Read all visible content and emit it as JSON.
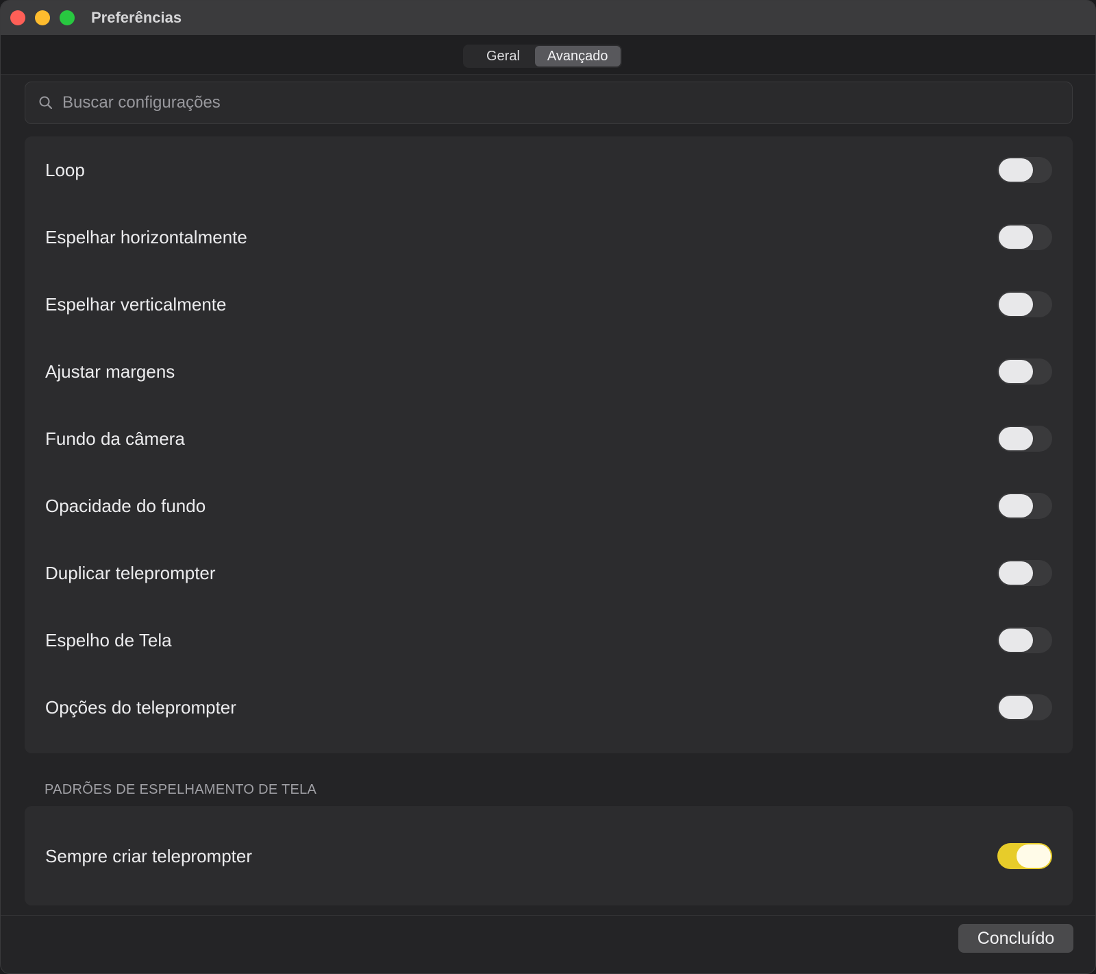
{
  "window": {
    "title": "Preferências"
  },
  "tabs": [
    {
      "label": "Geral",
      "active": false
    },
    {
      "label": "Avançado",
      "active": true
    }
  ],
  "search": {
    "placeholder": "Buscar configurações",
    "value": "",
    "icon": "search-icon"
  },
  "settings": [
    {
      "label": "Loop",
      "on": false
    },
    {
      "label": "Espelhar horizontalmente",
      "on": false
    },
    {
      "label": "Espelhar verticalmente",
      "on": false
    },
    {
      "label": "Ajustar margens",
      "on": false
    },
    {
      "label": "Fundo da câmera",
      "on": false
    },
    {
      "label": "Opacidade do fundo",
      "on": false
    },
    {
      "label": "Duplicar teleprompter",
      "on": false
    },
    {
      "label": "Espelho de Tela",
      "on": false
    },
    {
      "label": "Opções do teleprompter",
      "on": false
    }
  ],
  "mirror_section": {
    "heading": "PADRÕES DE ESPELHAMENTO DE TELA",
    "settings": [
      {
        "label": "Sempre criar teleprompter",
        "on": true
      }
    ]
  },
  "footer": {
    "done_label": "Concluído"
  },
  "colors": {
    "accent_on": "#e7cc2a",
    "close": "#ff5f57",
    "minimize": "#febc2e",
    "maximize": "#28c840"
  }
}
